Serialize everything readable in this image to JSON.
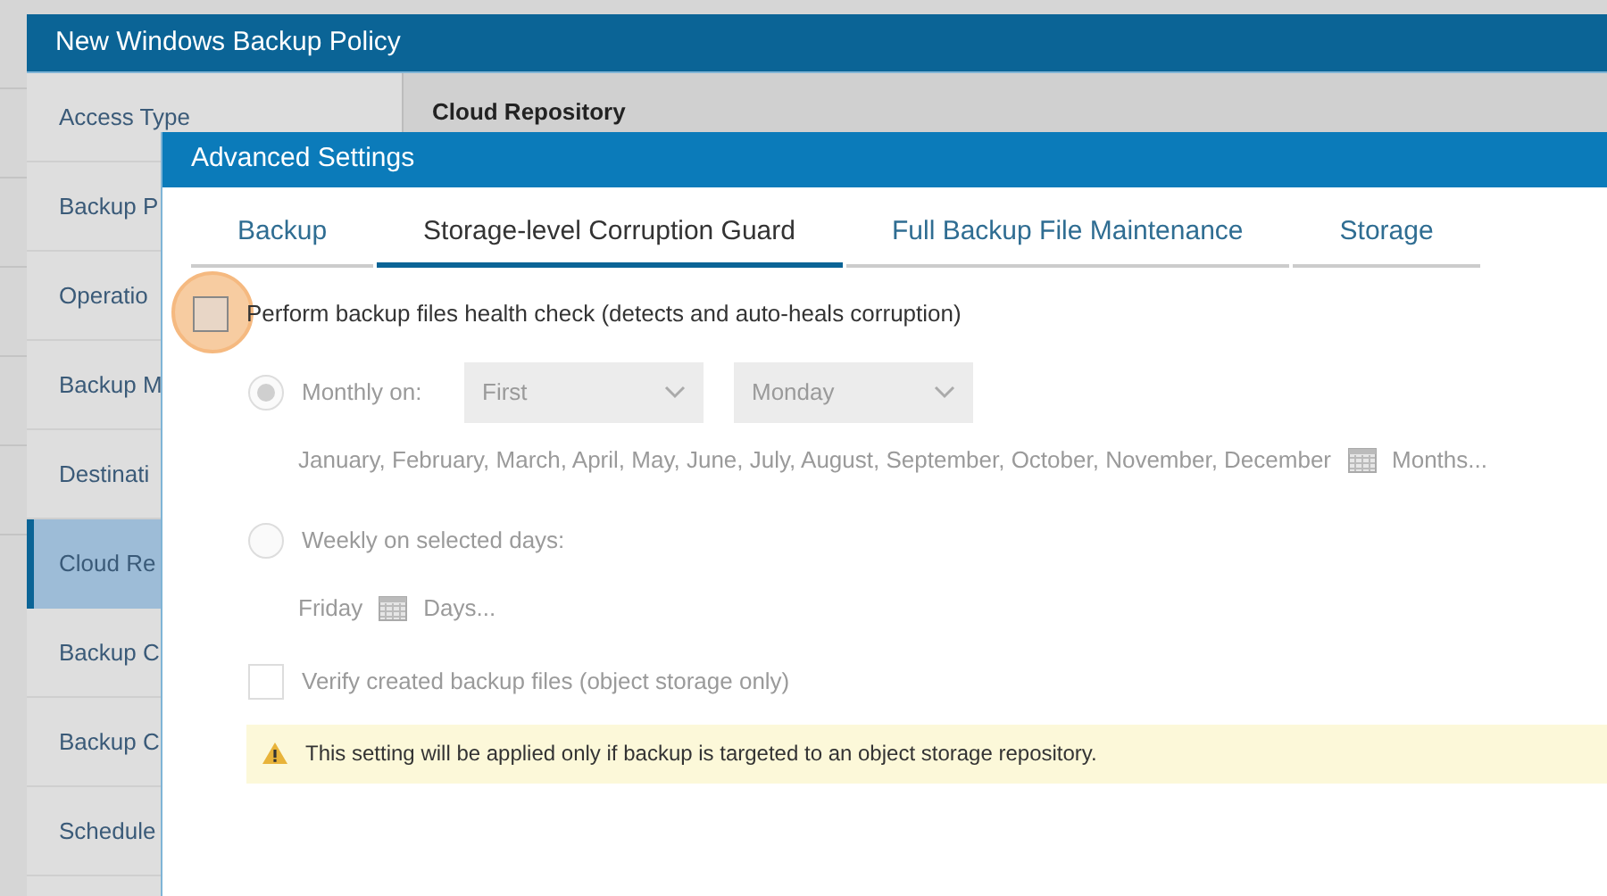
{
  "window": {
    "title": "New Windows Backup Policy"
  },
  "sidebar": {
    "items": [
      {
        "label": "Access Type",
        "selected": false
      },
      {
        "label": "Backup P",
        "selected": false
      },
      {
        "label": "Operatio",
        "selected": false
      },
      {
        "label": "Backup M",
        "selected": false
      },
      {
        "label": "Destinati",
        "selected": false
      },
      {
        "label": "Cloud Re",
        "selected": true
      },
      {
        "label": "Backup C",
        "selected": false
      },
      {
        "label": "Backup C",
        "selected": false
      },
      {
        "label": "Schedule",
        "selected": false
      }
    ]
  },
  "main": {
    "heading": "Cloud Repository"
  },
  "dialog": {
    "title": "Advanced Settings",
    "tabs": [
      {
        "label": "Backup",
        "selected": false
      },
      {
        "label": "Storage-level Corruption Guard",
        "selected": true
      },
      {
        "label": "Full Backup File Maintenance",
        "selected": false
      },
      {
        "label": "Storage",
        "selected": false
      }
    ],
    "health_check": {
      "label": "Perform backup files health check (detects and auto-heals corruption)",
      "checked": false,
      "highlighted": true
    },
    "schedule": [
      {
        "kind": "monthly",
        "label": "Monthly on:",
        "selected": true,
        "disabled": true,
        "dropdowns": [
          "First",
          "Monday"
        ],
        "detail": "January, February, March, April, May, June, July, August, September, October, November, December",
        "link": "Months..."
      },
      {
        "kind": "weekly",
        "label": "Weekly on selected days:",
        "selected": false,
        "disabled": true,
        "detail": "Friday",
        "link": "Days..."
      }
    ],
    "verify": {
      "label": "Verify created backup files (object storage only)",
      "checked": false,
      "disabled": true
    },
    "warning": "This setting will be applied only if backup is targeted to an object storage repository."
  }
}
